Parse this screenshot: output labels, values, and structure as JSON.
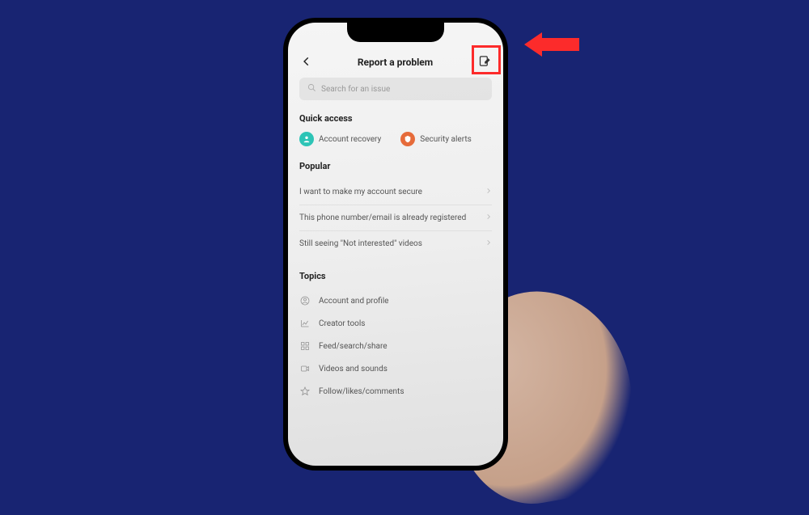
{
  "colors": {
    "background": "#182472",
    "highlight": "#fc2b2b",
    "teal": "#2dc4b6",
    "orange": "#e66b3a"
  },
  "header": {
    "title": "Report a problem"
  },
  "search": {
    "placeholder": "Search for an issue"
  },
  "quick_access": {
    "title": "Quick access",
    "items": [
      {
        "label": "Account recovery",
        "icon": "person-icon",
        "color": "teal"
      },
      {
        "label": "Security alerts",
        "icon": "shield-icon",
        "color": "orange"
      }
    ]
  },
  "popular": {
    "title": "Popular",
    "items": [
      {
        "label": "I want to make my account secure"
      },
      {
        "label": "This phone number/email is already registered"
      },
      {
        "label": "Still seeing \"Not interested\" videos"
      }
    ]
  },
  "topics": {
    "title": "Topics",
    "items": [
      {
        "label": "Account and profile",
        "icon": "user-circle-icon"
      },
      {
        "label": "Creator tools",
        "icon": "chart-icon"
      },
      {
        "label": "Feed/search/share",
        "icon": "grid-icon"
      },
      {
        "label": "Videos and sounds",
        "icon": "video-icon"
      },
      {
        "label": "Follow/likes/comments",
        "icon": "star-icon"
      }
    ]
  }
}
